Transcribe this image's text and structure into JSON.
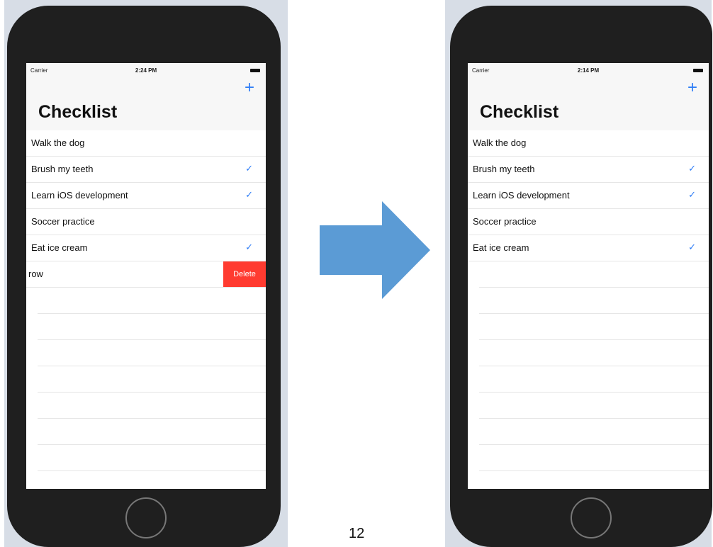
{
  "colors": {
    "accent": "#2f7df6",
    "delete": "#ff3b30",
    "arrow": "#5b9bd5"
  },
  "left_phone": {
    "status": {
      "carrier": "Carrier",
      "time": "2:24 PM"
    },
    "nav": {
      "add_label": "+",
      "title": "Checklist"
    },
    "rows": [
      {
        "label": "Walk the dog",
        "checked": false
      },
      {
        "label": "Brush my teeth",
        "checked": true
      },
      {
        "label": "Learn iOS development",
        "checked": true
      },
      {
        "label": "Soccer practice",
        "checked": false
      },
      {
        "label": "Eat ice cream",
        "checked": true
      }
    ],
    "swiped_row": {
      "label": "w row",
      "delete_label": "Delete"
    }
  },
  "right_phone": {
    "status": {
      "carrier": "Carrier",
      "time": "2:14 PM"
    },
    "nav": {
      "add_label": "+",
      "title": "Checklist"
    },
    "rows": [
      {
        "label": "Walk the dog",
        "checked": false
      },
      {
        "label": "Brush my teeth",
        "checked": true
      },
      {
        "label": "Learn iOS development",
        "checked": true
      },
      {
        "label": "Soccer practice",
        "checked": false
      },
      {
        "label": "Eat ice cream",
        "checked": true
      }
    ]
  },
  "checkmark": "✓",
  "page_number": "12"
}
